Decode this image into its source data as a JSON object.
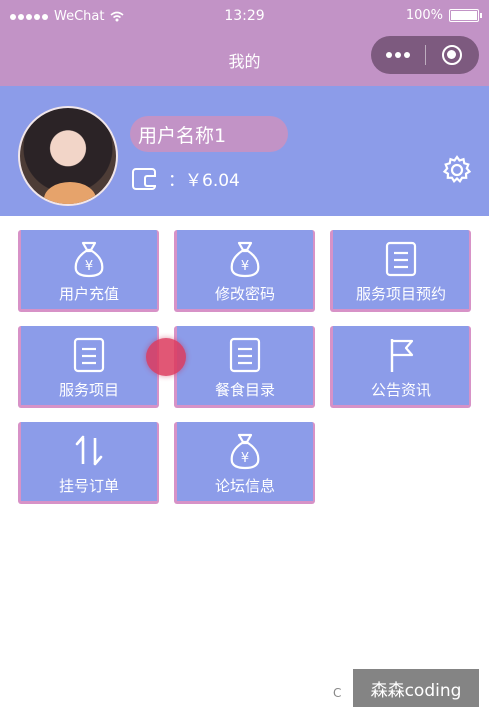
{
  "status_bar": {
    "carrier": "WeChat",
    "time": "13:29",
    "battery": "100%"
  },
  "nav": {
    "title": "我的"
  },
  "profile": {
    "username": "用户名称1",
    "balance": "：￥6.04"
  },
  "menu": [
    {
      "label": "用户充值",
      "icon": "money-bag-icon"
    },
    {
      "label": "修改密码",
      "icon": "money-bag-icon"
    },
    {
      "label": "服务项目预约",
      "icon": "document-icon"
    },
    {
      "label": "服务项目",
      "icon": "document-icon"
    },
    {
      "label": "餐食目录",
      "icon": "document-icon"
    },
    {
      "label": "公告资讯",
      "icon": "flag-icon"
    },
    {
      "label": "挂号订单",
      "icon": "sort-arrows-icon"
    },
    {
      "label": "论坛信息",
      "icon": "money-bag-icon"
    }
  ],
  "watermark": {
    "text": "森森coding",
    "prefix": "C"
  },
  "colors": {
    "header": "#c293c6",
    "card": "#8c9ce9",
    "card_border": "#d792c7",
    "capsule": "#7d5a7f"
  }
}
